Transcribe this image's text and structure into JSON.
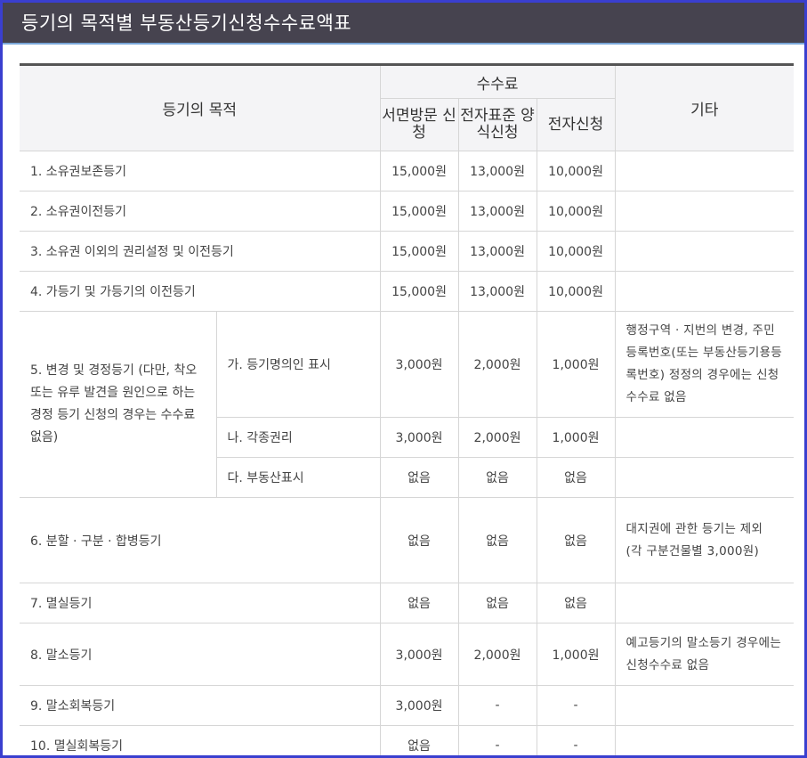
{
  "title": "등기의 목적별 부동산등기신청수수료액표",
  "header": {
    "purpose": "등기의 목적",
    "fee_group": "수수료",
    "paper_visit": "서면방문 신청",
    "e_standard": "전자표준 양식신청",
    "e_filing": "전자신청",
    "other": "기타"
  },
  "rows": [
    {
      "purpose": "1. 소유권보존등기",
      "paper": "15,000원",
      "std": "13,000원",
      "elec": "10,000원",
      "note": ""
    },
    {
      "purpose": "2. 소유권이전등기",
      "paper": "15,000원",
      "std": "13,000원",
      "elec": "10,000원",
      "note": ""
    },
    {
      "purpose": "3. 소유권 이외의 권리설정 및 이전등기",
      "paper": "15,000원",
      "std": "13,000원",
      "elec": "10,000원",
      "note": ""
    },
    {
      "purpose": "4. 가등기 및 가등기의 이전등기",
      "paper": "15,000원",
      "std": "13,000원",
      "elec": "10,000원",
      "note": ""
    }
  ],
  "change": {
    "purpose": "5. 변경 및 경정등기 (다만, 착오 또는 유루 발견을 원인으로 하는 경정 등기 신청의 경우는 수수료 없음)",
    "sub": [
      {
        "label": "가. 등기명의인 표시",
        "paper": "3,000원",
        "std": "2,000원",
        "elec": "1,000원",
        "note": "행정구역 · 지번의 변경, 주민등록번호(또는 부동산등기용등록번호) 정정의 경우에는 신청수수료 없음"
      },
      {
        "label": "나. 각종권리",
        "paper": "3,000원",
        "std": "2,000원",
        "elec": "1,000원",
        "note": ""
      },
      {
        "label": "다. 부동산표시",
        "paper": "없음",
        "std": "없음",
        "elec": "없음",
        "note": ""
      }
    ]
  },
  "rows2": [
    {
      "purpose": "6. 분할 · 구분 · 합병등기",
      "paper": "없음",
      "std": "없음",
      "elec": "없음",
      "note": "대지권에 관한 등기는 제외 (각 구분건물별 3,000원)"
    },
    {
      "purpose": "7. 멸실등기",
      "paper": "없음",
      "std": "없음",
      "elec": "없음",
      "note": ""
    },
    {
      "purpose": "8. 말소등기",
      "paper": "3,000원",
      "std": "2,000원",
      "elec": "1,000원",
      "note": "예고등기의 말소등기 경우에는 신청수수료 없음"
    },
    {
      "purpose": "9. 말소회복등기",
      "paper": "3,000원",
      "std": "-",
      "elec": "-",
      "note": ""
    },
    {
      "purpose": "10. 멸실회복등기",
      "paper": "없음",
      "std": "-",
      "elec": "-",
      "note": ""
    }
  ]
}
